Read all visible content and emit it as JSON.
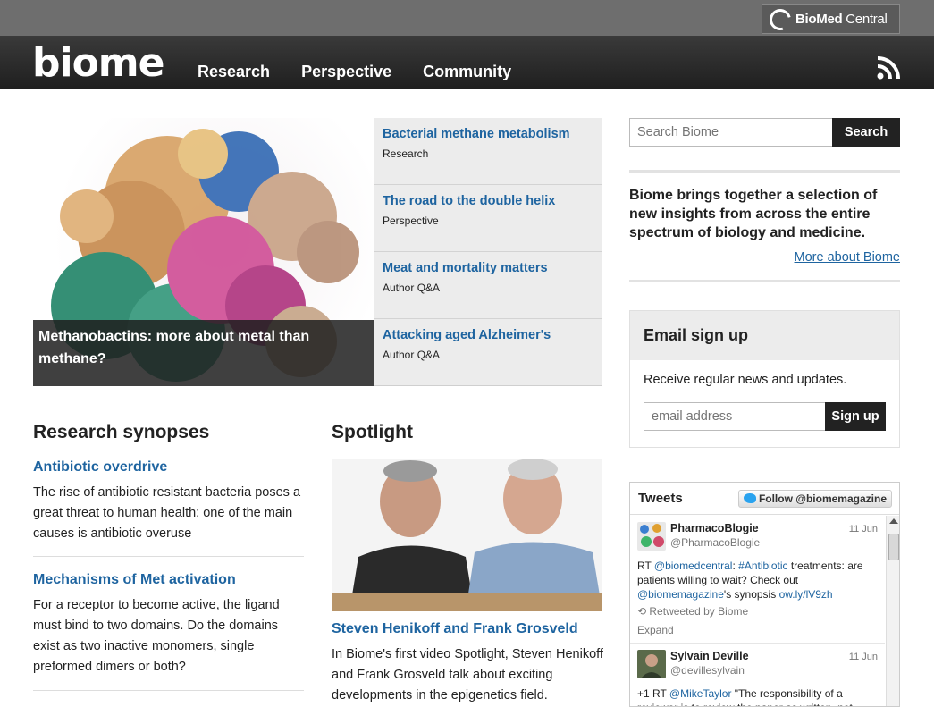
{
  "header": {
    "partner_logo_bold": "BioMed",
    "partner_logo_rest": " Central",
    "brand": "biome",
    "nav": [
      "Research",
      "Perspective",
      "Community"
    ]
  },
  "hero": {
    "caption": "Methanobactins: more about metal than methane?"
  },
  "featured": [
    {
      "title": "Bacterial methane metabolism",
      "type": "Research"
    },
    {
      "title": "The road to the double helix",
      "type": "Perspective"
    },
    {
      "title": "Meat and mortality matters",
      "type": "Author Q&A"
    },
    {
      "title": "Attacking aged Alzheimer's",
      "type": "Author Q&A"
    }
  ],
  "synopses": {
    "heading": "Research synopses",
    "items": [
      {
        "title": "Antibiotic overdrive",
        "text": "The rise of antibiotic resistant bacteria poses a great threat to human health; one of the main causes is antibiotic overuse"
      },
      {
        "title": "Mechanisms of Met activation",
        "text": "For a receptor to become active, the ligand must bind to two domains. Do the domains exist as two inactive monomers, single preformed dimers or both?"
      }
    ]
  },
  "spotlight": {
    "heading": "Spotlight",
    "title": "Steven Henikoff and Frank Grosveld",
    "text": "In Biome's first video Spotlight, Steven Henikoff and Frank Grosveld talk about exciting developments in the epigenetics field."
  },
  "search": {
    "placeholder": "Search Biome",
    "button": "Search"
  },
  "about": {
    "text": "Biome brings together a selection of new insights from across the entire spectrum of biology and medicine.",
    "link": "More about Biome"
  },
  "email": {
    "heading": "Email sign up",
    "text": "Receive regular news and updates.",
    "placeholder": "email address",
    "button": "Sign up"
  },
  "tweets": {
    "heading": "Tweets",
    "follow": "Follow @biomemagazine",
    "items": [
      {
        "name": "PharmacoBlogie",
        "handle": "@PharmacoBlogie",
        "date": "11 Jun",
        "body_a": "RT ",
        "link_a": "@biomedcentral",
        "body_b": ": ",
        "link_b": "#Antibiotic",
        "body_c": " treatments: are patients willing to wait? Check out ",
        "link_c": "@biomemagazine",
        "body_d": "'s synopsis ",
        "link_d": "ow.ly/lV9zh",
        "retweeted": "Retweeted by Biome",
        "expand": "Expand"
      },
      {
        "name": "Sylvain Deville",
        "handle": "@devillesylvain",
        "date": "11 Jun",
        "body_a": "+1 RT ",
        "link_a": "@MikeTaylor",
        "body_b": " \"The responsibility of a reviewer is to review the paper as written, not"
      }
    ]
  },
  "colors": {
    "link": "#1e64a0",
    "nav_bg": "#2a2a2a",
    "top_strip": "#6e6e6e",
    "button_bg": "#222222"
  }
}
